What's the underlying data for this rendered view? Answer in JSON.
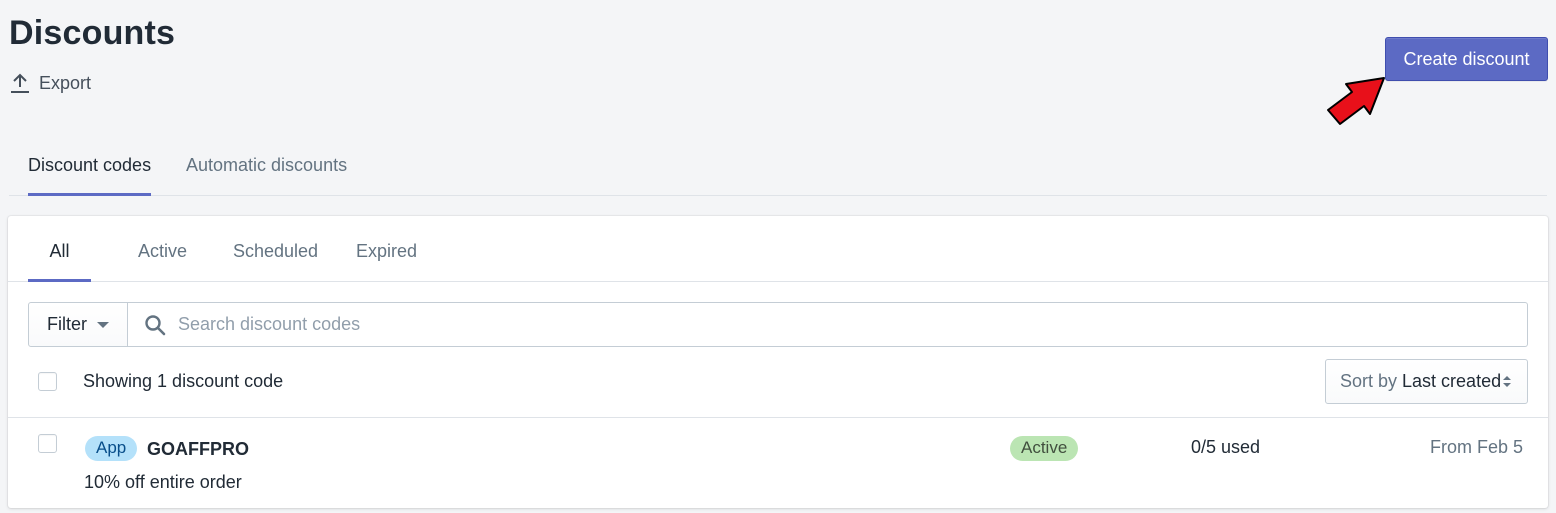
{
  "page": {
    "title": "Discounts",
    "export_label": "Export",
    "create_button_label": "Create discount"
  },
  "outer_tabs": [
    {
      "label": "Discount codes",
      "active": true
    },
    {
      "label": "Automatic discounts",
      "active": false
    }
  ],
  "inner_tabs": [
    {
      "label": "All",
      "active": true
    },
    {
      "label": "Active",
      "active": false
    },
    {
      "label": "Scheduled",
      "active": false
    },
    {
      "label": "Expired",
      "active": false
    }
  ],
  "filter": {
    "button_label": "Filter",
    "search_placeholder": "Search discount codes",
    "search_value": ""
  },
  "list_header": {
    "showing_text": "Showing 1 discount code",
    "sort_prefix": "Sort by",
    "sort_value": "Last created"
  },
  "discounts": [
    {
      "badge": "App",
      "code": "GOAFFPRO",
      "description": "10% off entire order",
      "status": "Active",
      "usage": "0/5 used",
      "date": "From Feb 5"
    }
  ],
  "colors": {
    "accent": "#5c6ac4",
    "app_badge_bg": "#b4e1fa",
    "status_active_bg": "#bbe5b3",
    "annotation_arrow": "#e8101a"
  },
  "icons": {
    "export": "export-upload-icon",
    "search": "search-icon",
    "filter_caret": "chevron-down-icon",
    "sort": "sort-arrows-icon",
    "annotation": "red-arrow-annotation"
  }
}
